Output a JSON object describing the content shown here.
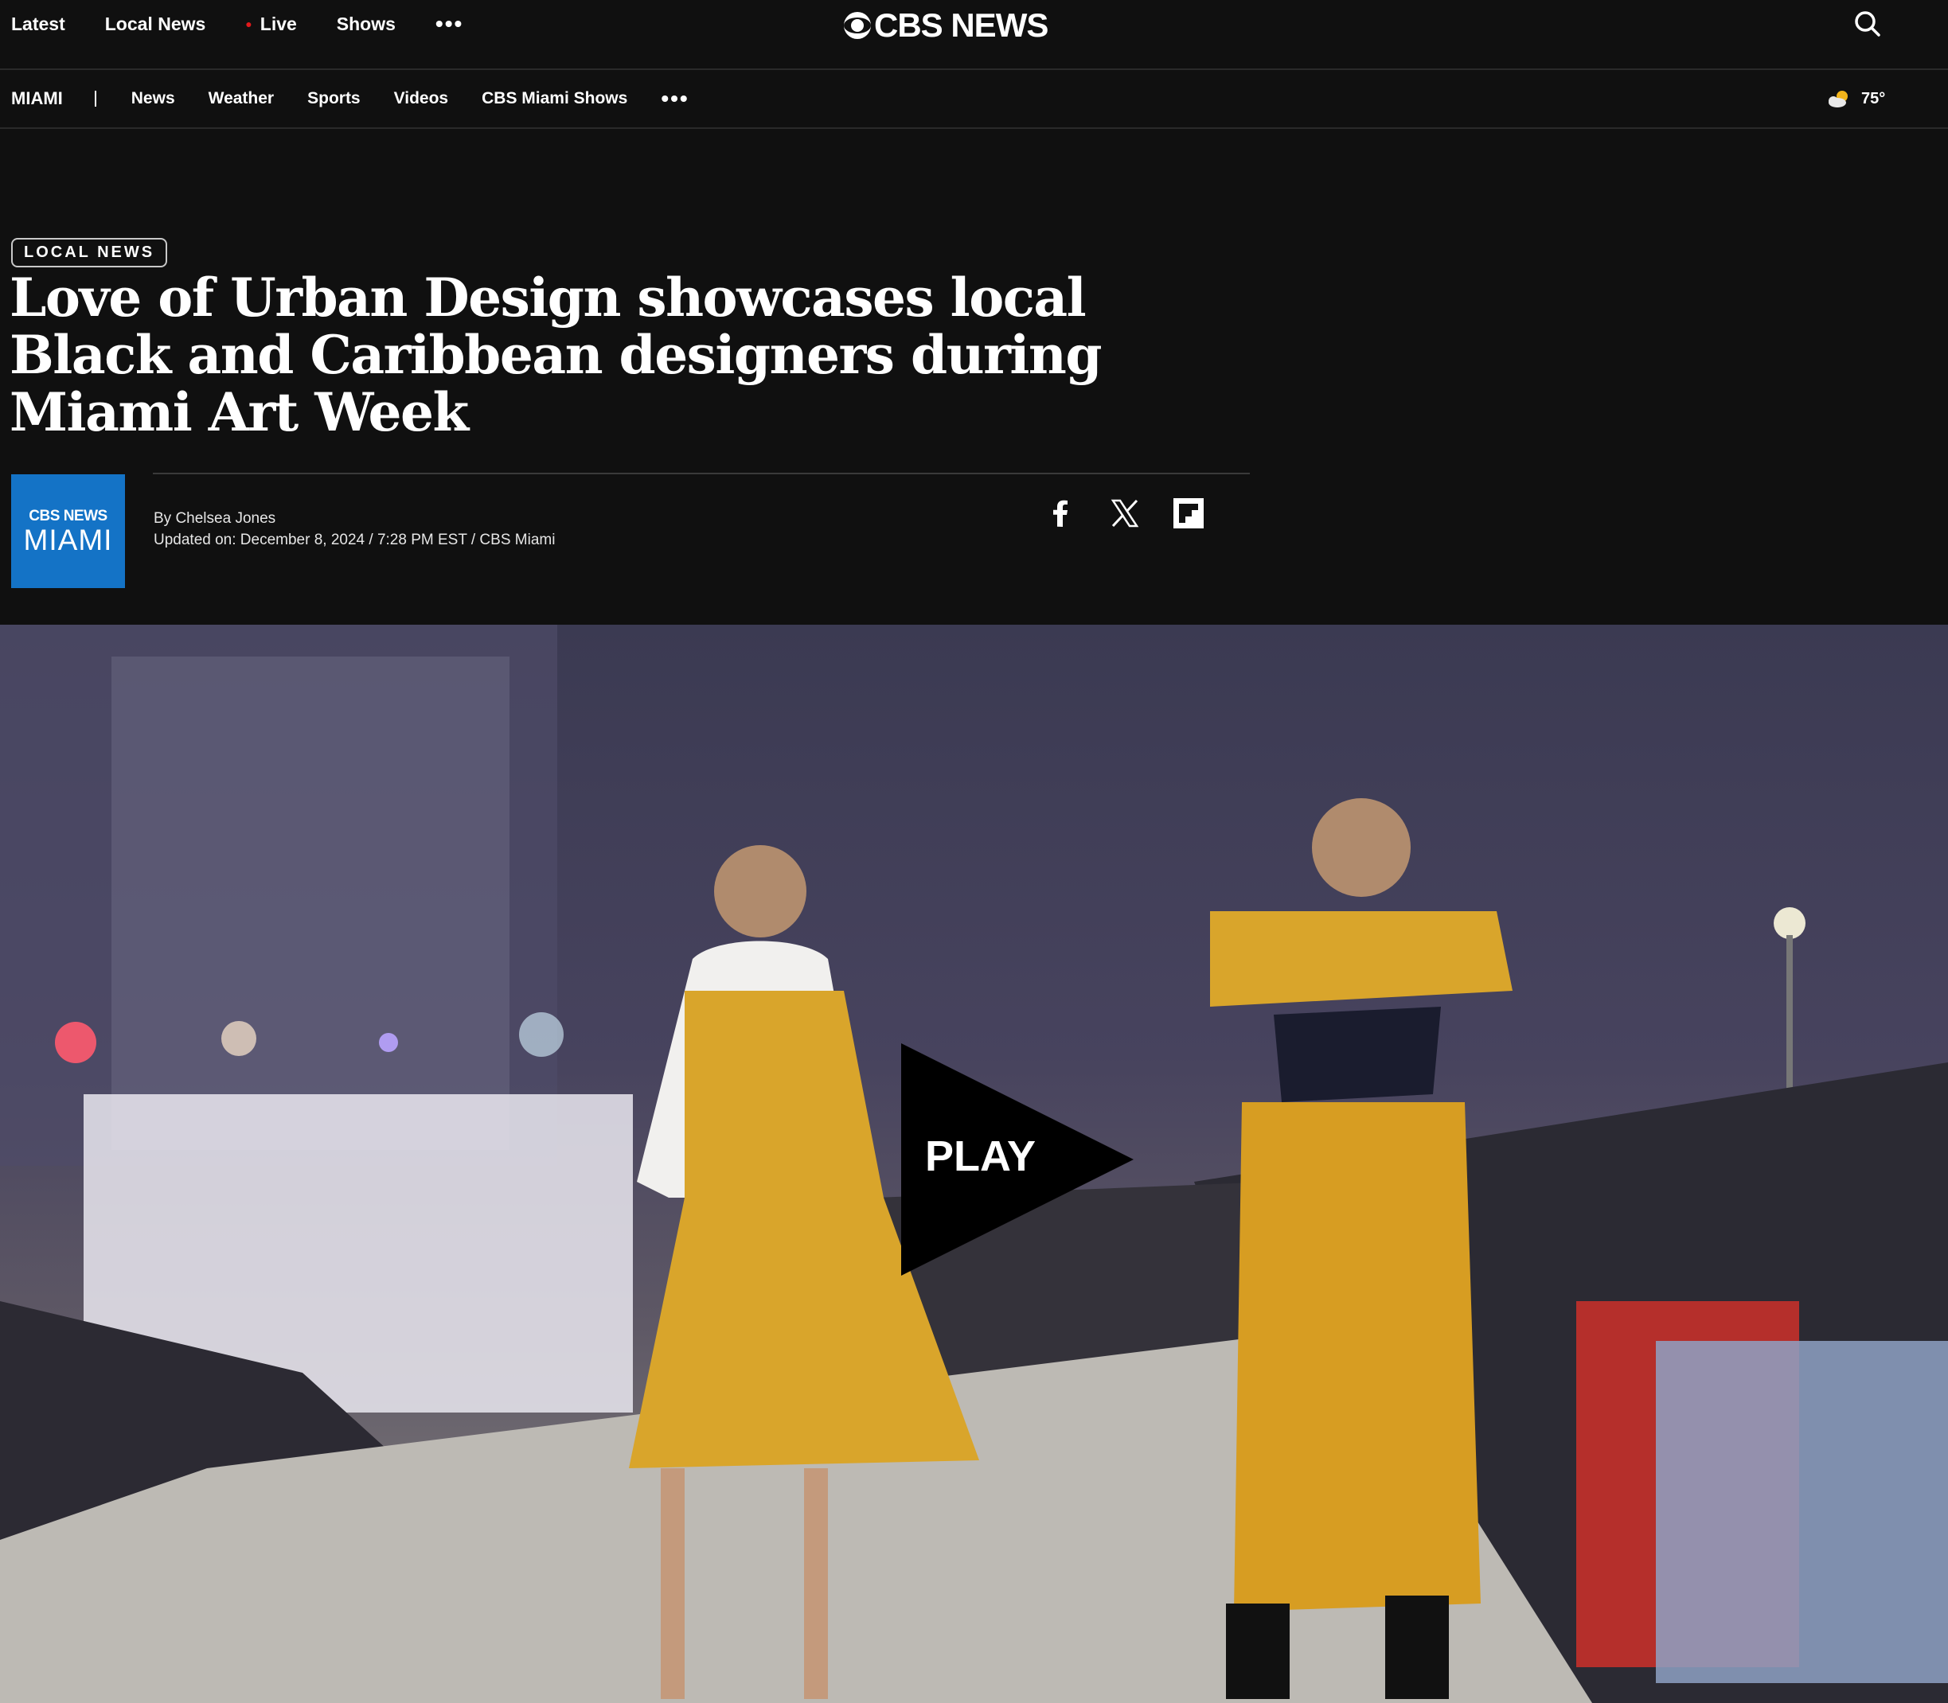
{
  "topnav": {
    "items": [
      {
        "label": "Latest"
      },
      {
        "label": "Local News"
      },
      {
        "label": "Live"
      },
      {
        "label": "Shows"
      }
    ],
    "more_label": "•••"
  },
  "brand": {
    "name": "CBS NEWS",
    "icon": "cbs-eye-icon"
  },
  "search": {
    "icon": "search-icon"
  },
  "subnav": {
    "section": "MIAMI",
    "items": [
      {
        "label": "News"
      },
      {
        "label": "Weather"
      },
      {
        "label": "Sports"
      },
      {
        "label": "Videos"
      },
      {
        "label": "CBS Miami Shows"
      }
    ],
    "more_label": "•••"
  },
  "weather": {
    "temp": "75°",
    "icon": "partly-cloudy-icon"
  },
  "article": {
    "tag": "LOCAL NEWS",
    "headline": "Love of Urban Design showcases local Black and Caribbean designers during Miami Art Week",
    "station_logo_top": "CBS NEWS",
    "station_logo_bottom": "MIAMI",
    "author": "By Chelsea Jones",
    "updated": "Updated on: December 8, 2024 / 7:28 PM EST / CBS Miami"
  },
  "share": [
    {
      "icon": "facebook-icon"
    },
    {
      "icon": "x-icon"
    },
    {
      "icon": "flipboard-icon"
    }
  ],
  "video": {
    "play_label": "PLAY"
  },
  "colors": {
    "background": "#101010",
    "live_dot": "#e2191b",
    "station_blue": "#1473c6"
  }
}
